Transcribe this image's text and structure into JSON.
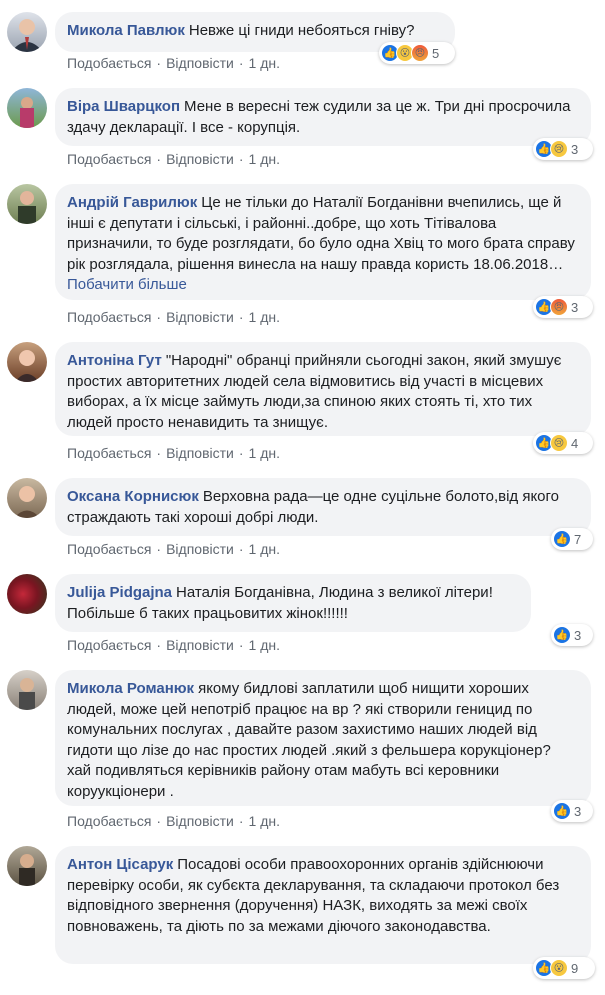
{
  "actions": {
    "like": "Подобається",
    "reply": "Відповісти",
    "dot": "·"
  },
  "comments": [
    {
      "name": "Микола Павлюк",
      "text": "Невже ці гниди небояться гніву?",
      "time": "1 дн.",
      "reactions": [
        "like",
        "wow",
        "angry"
      ],
      "count": "5"
    },
    {
      "name": "Віра Шварцкоп",
      "text": "Мене в вересні теж судили за це ж. Три дні просрочила здачу декларації. І все - корупція.",
      "time": "1 дн.",
      "reactions": [
        "like",
        "sad"
      ],
      "count": "3"
    },
    {
      "name": "Андрій Гаврилюк",
      "text": "Це не тільки до Наталії Богданівни вчепились, ще й інші є депутати і сільські, і районні..добре, що хоть Тітівалова призначили, то буде розглядати, бо було одна Хвіц то мого брата справу рік розглядала, рішення винесла на нашу правда користь 18.06.2018…",
      "see_more": "Побачити більше",
      "time": "1 дн.",
      "reactions": [
        "like",
        "angry"
      ],
      "count": "3"
    },
    {
      "name": "Антоніна Гут",
      "text": "\"Народні\" обранці прийняли сьогодні закон, який змушує простих авторитетних людей села відмовитись від участі в місцевих виборах, а їх місце займуть люди,за спиною яких стоять ті, хто тих людей просто ненавидить та знищує.",
      "time": "1 дн.",
      "reactions": [
        "like",
        "sad"
      ],
      "count": "4"
    },
    {
      "name": "Оксана Корнисюк",
      "text": "Верховна рада—це одне суцільне болото,від якого страждають такі хороші добрі люди.",
      "time": "1 дн.",
      "reactions": [
        "like"
      ],
      "count": "7"
    },
    {
      "name": "Julija Pidgajna",
      "text": "Наталія Богданівна, Людина з великої літери! Побільше б таких працьовитих жінок!!!!!!",
      "time": "1 дн.",
      "reactions": [
        "like"
      ],
      "count": "3"
    },
    {
      "name": "Микола Романюк",
      "text": "якому бидлові заплатили щоб нищити хороших людей, може цей непотріб працює на вр ? які створили геницид по комунальних послугах , давайте разом захистимо наших людей від гидоти що лізе до нас простих людей .який з фельшера корукціонер? хай подивляться керівників району отам мабуть всі керовники коруукціонери .",
      "time": "1 дн.",
      "reactions": [
        "like"
      ],
      "count": "3"
    },
    {
      "name": "Антон Цісарук",
      "text": "Посадові особи правоохоронних органів здійснюючи перевірку особи, як субєкта декларування, та складаючи протокол без відповідного звернення (доручення) НАЗК, виходять за межі своїх повноважень, та діють по за межами діючого законодавства.",
      "time": "",
      "reactions": [
        "like",
        "wow"
      ],
      "count": "9"
    }
  ]
}
